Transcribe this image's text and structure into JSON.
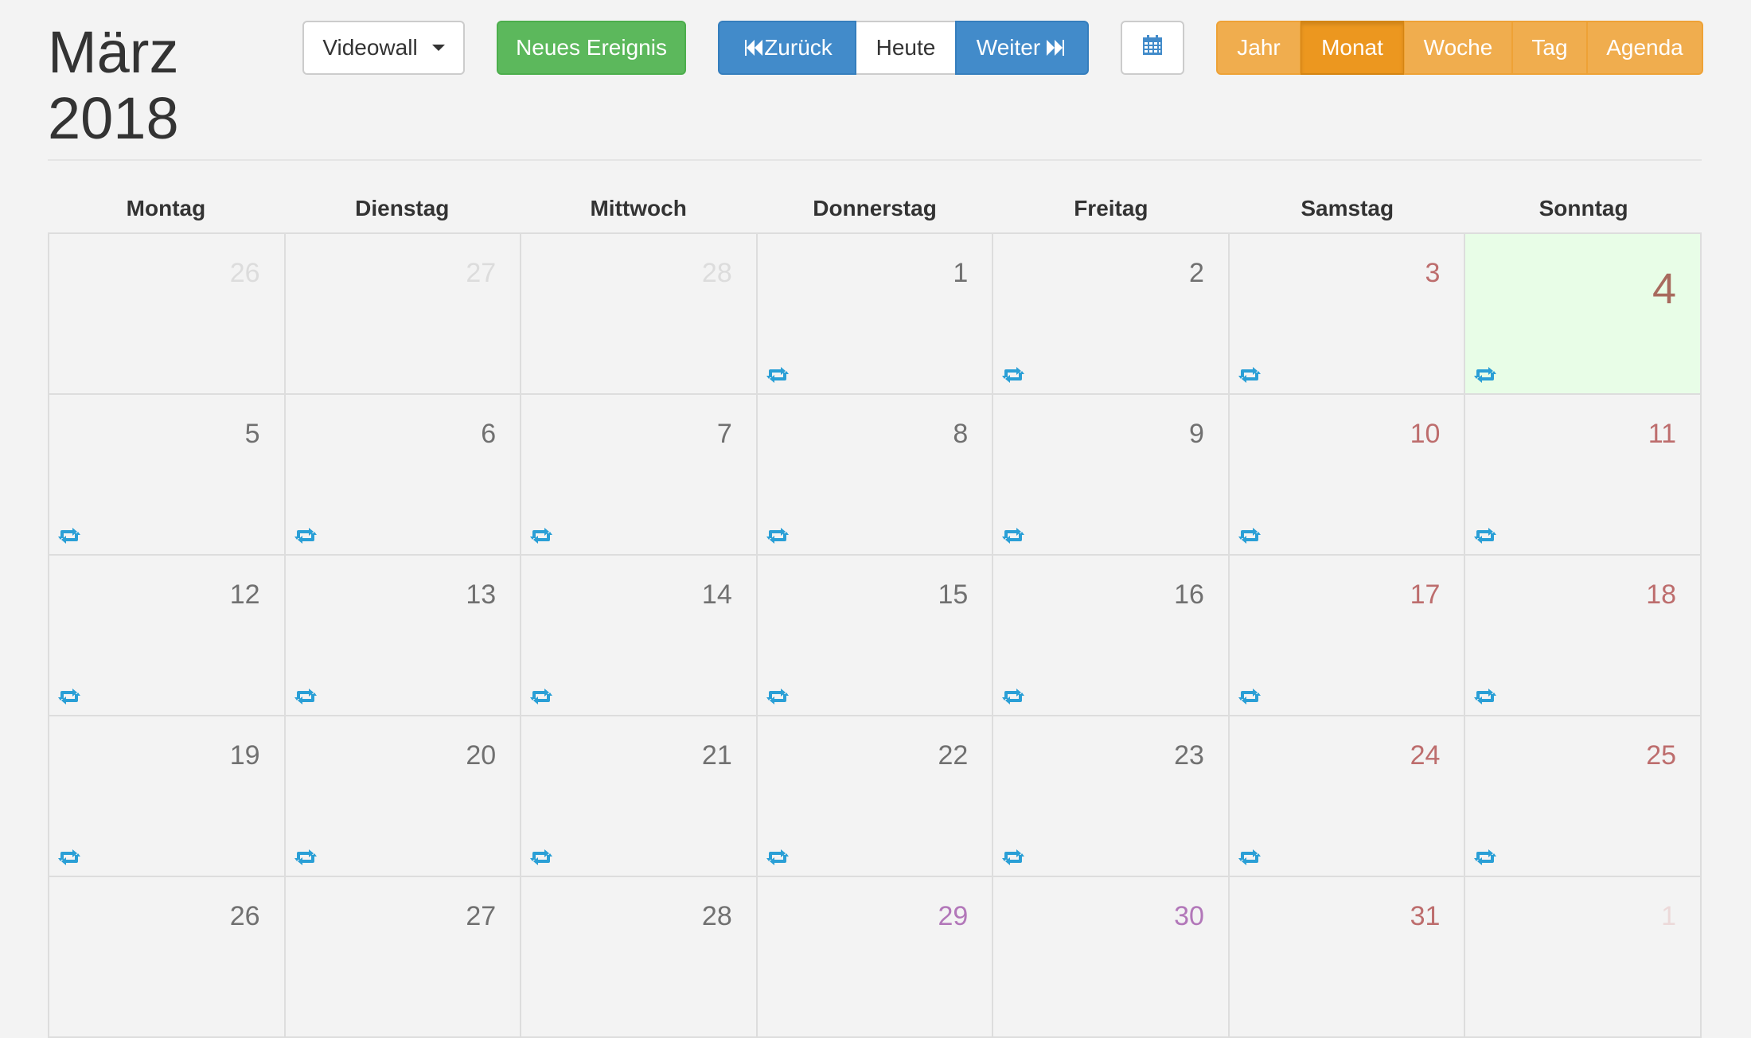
{
  "header": {
    "title_month": "März",
    "title_year": "2018"
  },
  "toolbar": {
    "calendar_select_label": "Videowall",
    "new_event_label": "Neues Ereignis",
    "prev_label": "Zurück",
    "today_label": "Heute",
    "next_label": "Weiter",
    "datepicker_icon": "calendar-icon",
    "views": {
      "year": "Jahr",
      "month": "Monat",
      "week": "Woche",
      "day": "Tag",
      "agenda": "Agenda"
    },
    "active_view": "month"
  },
  "colors": {
    "primary": "#428bca",
    "success": "#5cb85c",
    "warning": "#f0ad4e",
    "warning_active": "#ec971f",
    "today_bg": "#e8fde7",
    "weekend_text": "#bd6d6d",
    "holiday_text": "#b277b9",
    "recurring_icon": "#2a9fd6"
  },
  "weekdays": [
    "Montag",
    "Dienstag",
    "Mittwoch",
    "Donnerstag",
    "Freitag",
    "Samstag",
    "Sonntag"
  ],
  "weeks": [
    [
      {
        "day": "26",
        "type": "outside",
        "recurring": false
      },
      {
        "day": "27",
        "type": "outside",
        "recurring": false
      },
      {
        "day": "28",
        "type": "outside",
        "recurring": false
      },
      {
        "day": "1",
        "type": "normal",
        "recurring": true
      },
      {
        "day": "2",
        "type": "normal",
        "recurring": true
      },
      {
        "day": "3",
        "type": "weekend",
        "recurring": true
      },
      {
        "day": "4",
        "type": "today",
        "recurring": true
      }
    ],
    [
      {
        "day": "5",
        "type": "normal",
        "recurring": true
      },
      {
        "day": "6",
        "type": "normal",
        "recurring": true
      },
      {
        "day": "7",
        "type": "normal",
        "recurring": true
      },
      {
        "day": "8",
        "type": "normal",
        "recurring": true
      },
      {
        "day": "9",
        "type": "normal",
        "recurring": true
      },
      {
        "day": "10",
        "type": "weekend",
        "recurring": true
      },
      {
        "day": "11",
        "type": "weekend",
        "recurring": true
      }
    ],
    [
      {
        "day": "12",
        "type": "normal",
        "recurring": true
      },
      {
        "day": "13",
        "type": "normal",
        "recurring": true
      },
      {
        "day": "14",
        "type": "normal",
        "recurring": true
      },
      {
        "day": "15",
        "type": "normal",
        "recurring": true
      },
      {
        "day": "16",
        "type": "normal",
        "recurring": true
      },
      {
        "day": "17",
        "type": "weekend",
        "recurring": true
      },
      {
        "day": "18",
        "type": "weekend",
        "recurring": true
      }
    ],
    [
      {
        "day": "19",
        "type": "normal",
        "recurring": true
      },
      {
        "day": "20",
        "type": "normal",
        "recurring": true
      },
      {
        "day": "21",
        "type": "normal",
        "recurring": true
      },
      {
        "day": "22",
        "type": "normal",
        "recurring": true
      },
      {
        "day": "23",
        "type": "normal",
        "recurring": true
      },
      {
        "day": "24",
        "type": "weekend",
        "recurring": true
      },
      {
        "day": "25",
        "type": "weekend",
        "recurring": true
      }
    ],
    [
      {
        "day": "26",
        "type": "normal",
        "recurring": false
      },
      {
        "day": "27",
        "type": "normal",
        "recurring": false
      },
      {
        "day": "28",
        "type": "normal",
        "recurring": false
      },
      {
        "day": "29",
        "type": "holiday",
        "recurring": false
      },
      {
        "day": "30",
        "type": "holiday",
        "recurring": false
      },
      {
        "day": "31",
        "type": "weekend",
        "recurring": false
      },
      {
        "day": "1",
        "type": "weekend-outside",
        "recurring": false
      }
    ]
  ]
}
